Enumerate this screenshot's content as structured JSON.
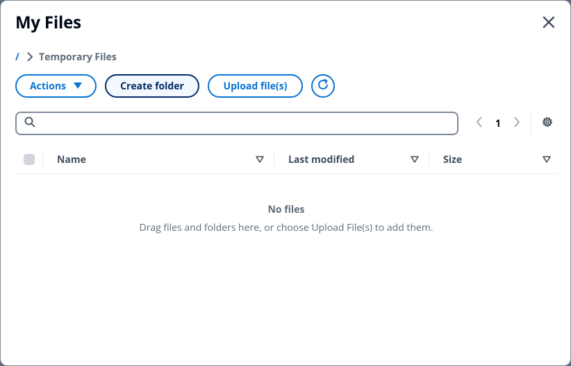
{
  "dialog": {
    "title": "My Files"
  },
  "breadcrumb": {
    "root": "/",
    "current": "Temporary Files"
  },
  "toolbar": {
    "actions_label": "Actions",
    "create_folder_label": "Create folder",
    "upload_label": "Upload file(s)"
  },
  "search": {
    "value": "",
    "placeholder": ""
  },
  "pagination": {
    "current_page": "1"
  },
  "table": {
    "columns": [
      {
        "label": "Name"
      },
      {
        "label": "Last modified"
      },
      {
        "label": "Size"
      }
    ],
    "rows": []
  },
  "empty_state": {
    "title": "No files",
    "description": "Drag files and folders here, or choose Upload File(s) to add them."
  },
  "colors": {
    "accent": "#0972d3",
    "accent_dark": "#002b66",
    "text_primary": "#000716",
    "text_secondary": "#5f6b7a",
    "border": "#7d8998"
  },
  "icons": {
    "close": "close-icon",
    "breadcrumb_separator": "chevron-right-icon",
    "actions_caret": "caret-down-icon",
    "refresh": "refresh-icon",
    "search": "search-icon",
    "prev_page": "chevron-left-icon",
    "next_page": "chevron-right-icon",
    "settings": "gear-icon",
    "sort": "sort-caret-icon"
  }
}
